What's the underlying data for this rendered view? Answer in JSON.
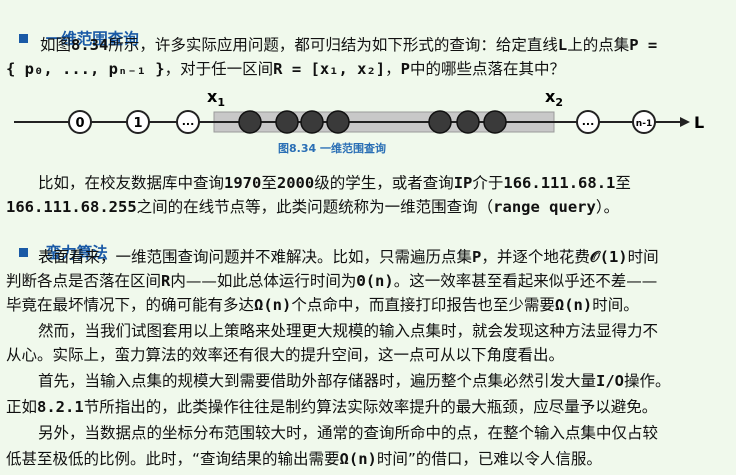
{
  "section1": {
    "title": "一维范围查询",
    "para1_line1_a": "如图",
    "para1_line1_fig": "8.34",
    "para1_line1_b": "所示，许多实际应用问题，都可归结为如下形式的查询：给定直线",
    "para1_line1_L": "L",
    "para1_line1_c": "上的点集",
    "para1_line1_P": "P =",
    "para1_line2_a": "{ p₀, ..., pₙ₋₁ }",
    "para1_line2_b": "，对于任一区间",
    "para1_line2_R": "R = [x₁, x₂]",
    "para1_line2_c": "，",
    "para1_line2_P": "P",
    "para1_line2_d": "中的哪些点落在其中？"
  },
  "figure": {
    "x1_label": "x",
    "x1_sub": "1",
    "x2_label": "x",
    "x2_sub": "2",
    "axis_label": "L",
    "node_labels": [
      "0",
      "1",
      "...",
      "...",
      "n-1"
    ],
    "caption": "图8.34  一维范围查询"
  },
  "para2": {
    "line1_a": "比如，在校友数据库中查询",
    "line1_y1": "1970",
    "line1_b": "至",
    "line1_y2": "2000",
    "line1_c": "级的学生，或者查询",
    "line1_ip": "IP",
    "line1_d": "介于",
    "line1_addr1": "166.111.68.1",
    "line1_e": "至",
    "line2_addr2": "166.111.68.255",
    "line2_a": "之间的在线节点等，此类问题统称为一维范围查询（",
    "line2_term": "range query",
    "line2_b": "）。"
  },
  "section2": {
    "title": "蛮力算法",
    "l1_a": "表面看来，一维范围查询问题并不难解决。比如，只需遍历点集",
    "l1_P": "P",
    "l1_b": "，并逐个地花费",
    "l1_o": "𝒪(1)",
    "l1_c": "时间",
    "l2_a": "判断各点是否落在区间",
    "l2_R": "R",
    "l2_b": "内——如此总体运行时间为",
    "l2_theta": "Θ(n)",
    "l2_c": "。这一效率甚至看起来似乎还不差——",
    "l3_a": "毕竟在最坏情况下，的确可能有多达",
    "l3_omega": "Ω(n)",
    "l3_b": "个点命中，而直接打印报告也至少需要",
    "l3_omega2": "Ω(n)",
    "l3_c": "时间。",
    "l4": "然而，当我们试图套用以上策略来处理更大规模的输入点集时，就会发现这种方法显得力不",
    "l5": "从心。实际上，蛮力算法的效率还有很大的提升空间，这一点可从以下角度看出。",
    "l6_a": "首先，当输入点集的规模大到需要借助外部存储器时，遍历整个点集必然引发大量",
    "l6_io": "I/O",
    "l6_b": "操作。",
    "l7_a": "正如",
    "l7_sec": "8.2.1",
    "l7_b": "节所指出的，此类操作往往是制约算法实际效率提升的最大瓶颈，应尽量予以避免。",
    "l8": "另外，当数据点的坐标分布范围较大时，通常的查询所命中的点，在整个输入点集中仅占较",
    "l9_a": "低甚至极低的比例。此时，“查询结果的输出需要",
    "l9_omega": "Ω(n)",
    "l9_b": "时间”的借口，已难以令人信服。"
  }
}
